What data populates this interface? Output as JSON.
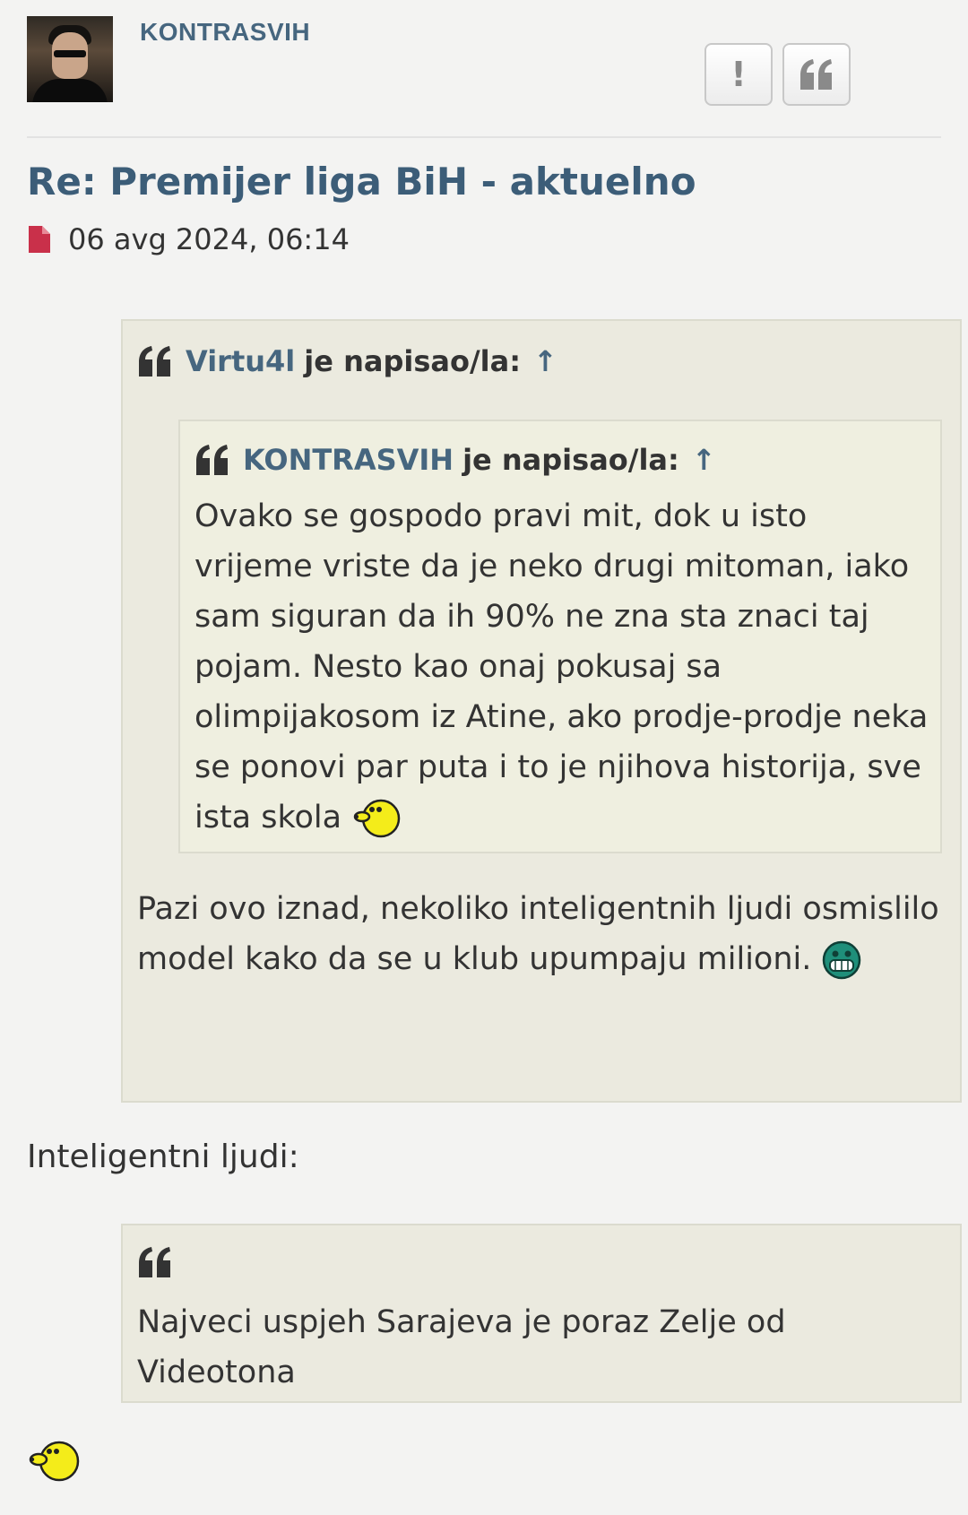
{
  "post": {
    "username": "KONTRASVIH",
    "report_label": "!",
    "title": "Re: Premijer liga BiH - aktuelno",
    "date": "06 avg 2024, 06:14",
    "outer_quote": {
      "author": "Virtu4l",
      "says": "je napisao/la:",
      "up": "↑",
      "inner_quote": {
        "author": "KONTRASVIH",
        "says": "je napisao/la:",
        "up": "↑",
        "text": "Ovako se gospodo pravi mit, dok u isto vrijeme vriste da je neko drugi mitoman, iako sam siguran da ih 90% ne zna sta znaci taj pojam. Nesto kao onaj pokusaj sa olimpijakosom iz Atine, ako prodje-prodje neka se ponovi par puta i to je njihova historija, sve ista skola"
      },
      "text": "Pazi ovo iznad, nekoliko inteligentnih ljudi osmislilo model kako da se u klub upumpaju milioni."
    },
    "body_text": "Inteligentni ljudi:",
    "third_quote": {
      "text": "Najveci uspjeh Sarajeva je poraz Zelje od Videotona"
    },
    "colors": {
      "link": "#46667f",
      "title": "#3c5d78",
      "quote_bg": "#ebeadf",
      "inner_quote_bg": "#efefe0",
      "file_icon": "#c9304a"
    }
  }
}
